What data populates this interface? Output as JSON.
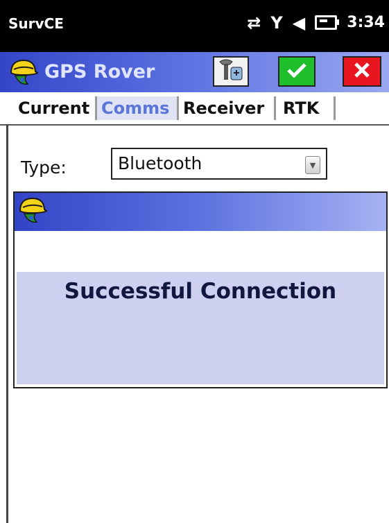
{
  "status_bar": {
    "app_name": "SurvCE",
    "time": "3:34",
    "icons": [
      "sync-arrows-icon",
      "signal-antenna-icon",
      "volume-icon",
      "battery-icon"
    ]
  },
  "title_bar": {
    "title": "GPS Rover",
    "buttons": [
      "configure-button",
      "ok-button",
      "cancel-button"
    ]
  },
  "tabs": [
    {
      "label": "Current",
      "active": false
    },
    {
      "label": "Comms",
      "active": true
    },
    {
      "label": "Receiver",
      "active": false
    },
    {
      "label": "RTK",
      "active": false
    }
  ],
  "form": {
    "type_label": "Type:",
    "type_value": "Bluetooth"
  },
  "dialog": {
    "message": "Successful Connection"
  },
  "colors": {
    "title_gradient_start": "#3446c8",
    "title_gradient_end": "#9aa8f0",
    "ok_green": "#1fbf2c",
    "cancel_red": "#e8161e",
    "active_tab": "#5a76d8",
    "dialog_body": "#cdd0ee"
  }
}
